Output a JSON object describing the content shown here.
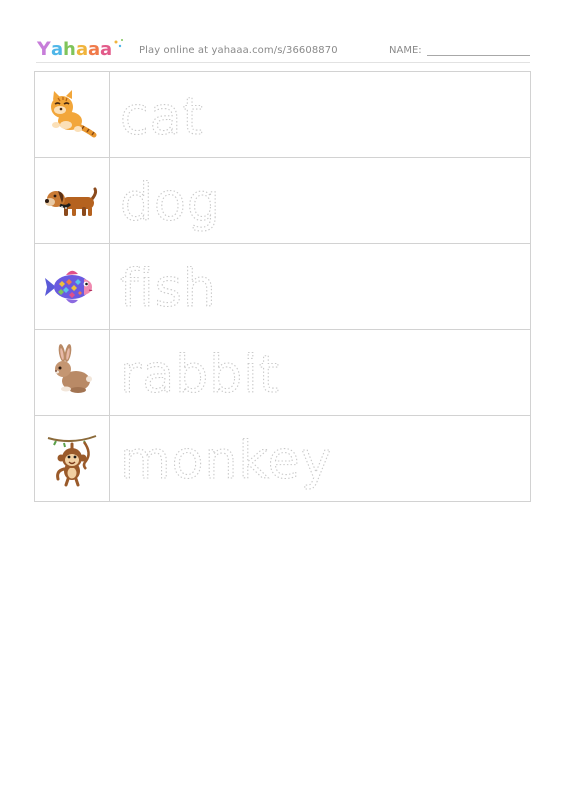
{
  "header": {
    "logo_text": "Yahaaa",
    "play_text": "Play online at yahaaa.com/s/36608870",
    "name_label": "NAME:"
  },
  "rows": [
    {
      "icon": "cat-icon",
      "word": "cat"
    },
    {
      "icon": "dog-icon",
      "word": "dog"
    },
    {
      "icon": "fish-icon",
      "word": "fish"
    },
    {
      "icon": "rabbit-icon",
      "word": "rabbit"
    },
    {
      "icon": "monkey-icon",
      "word": "monkey"
    }
  ]
}
